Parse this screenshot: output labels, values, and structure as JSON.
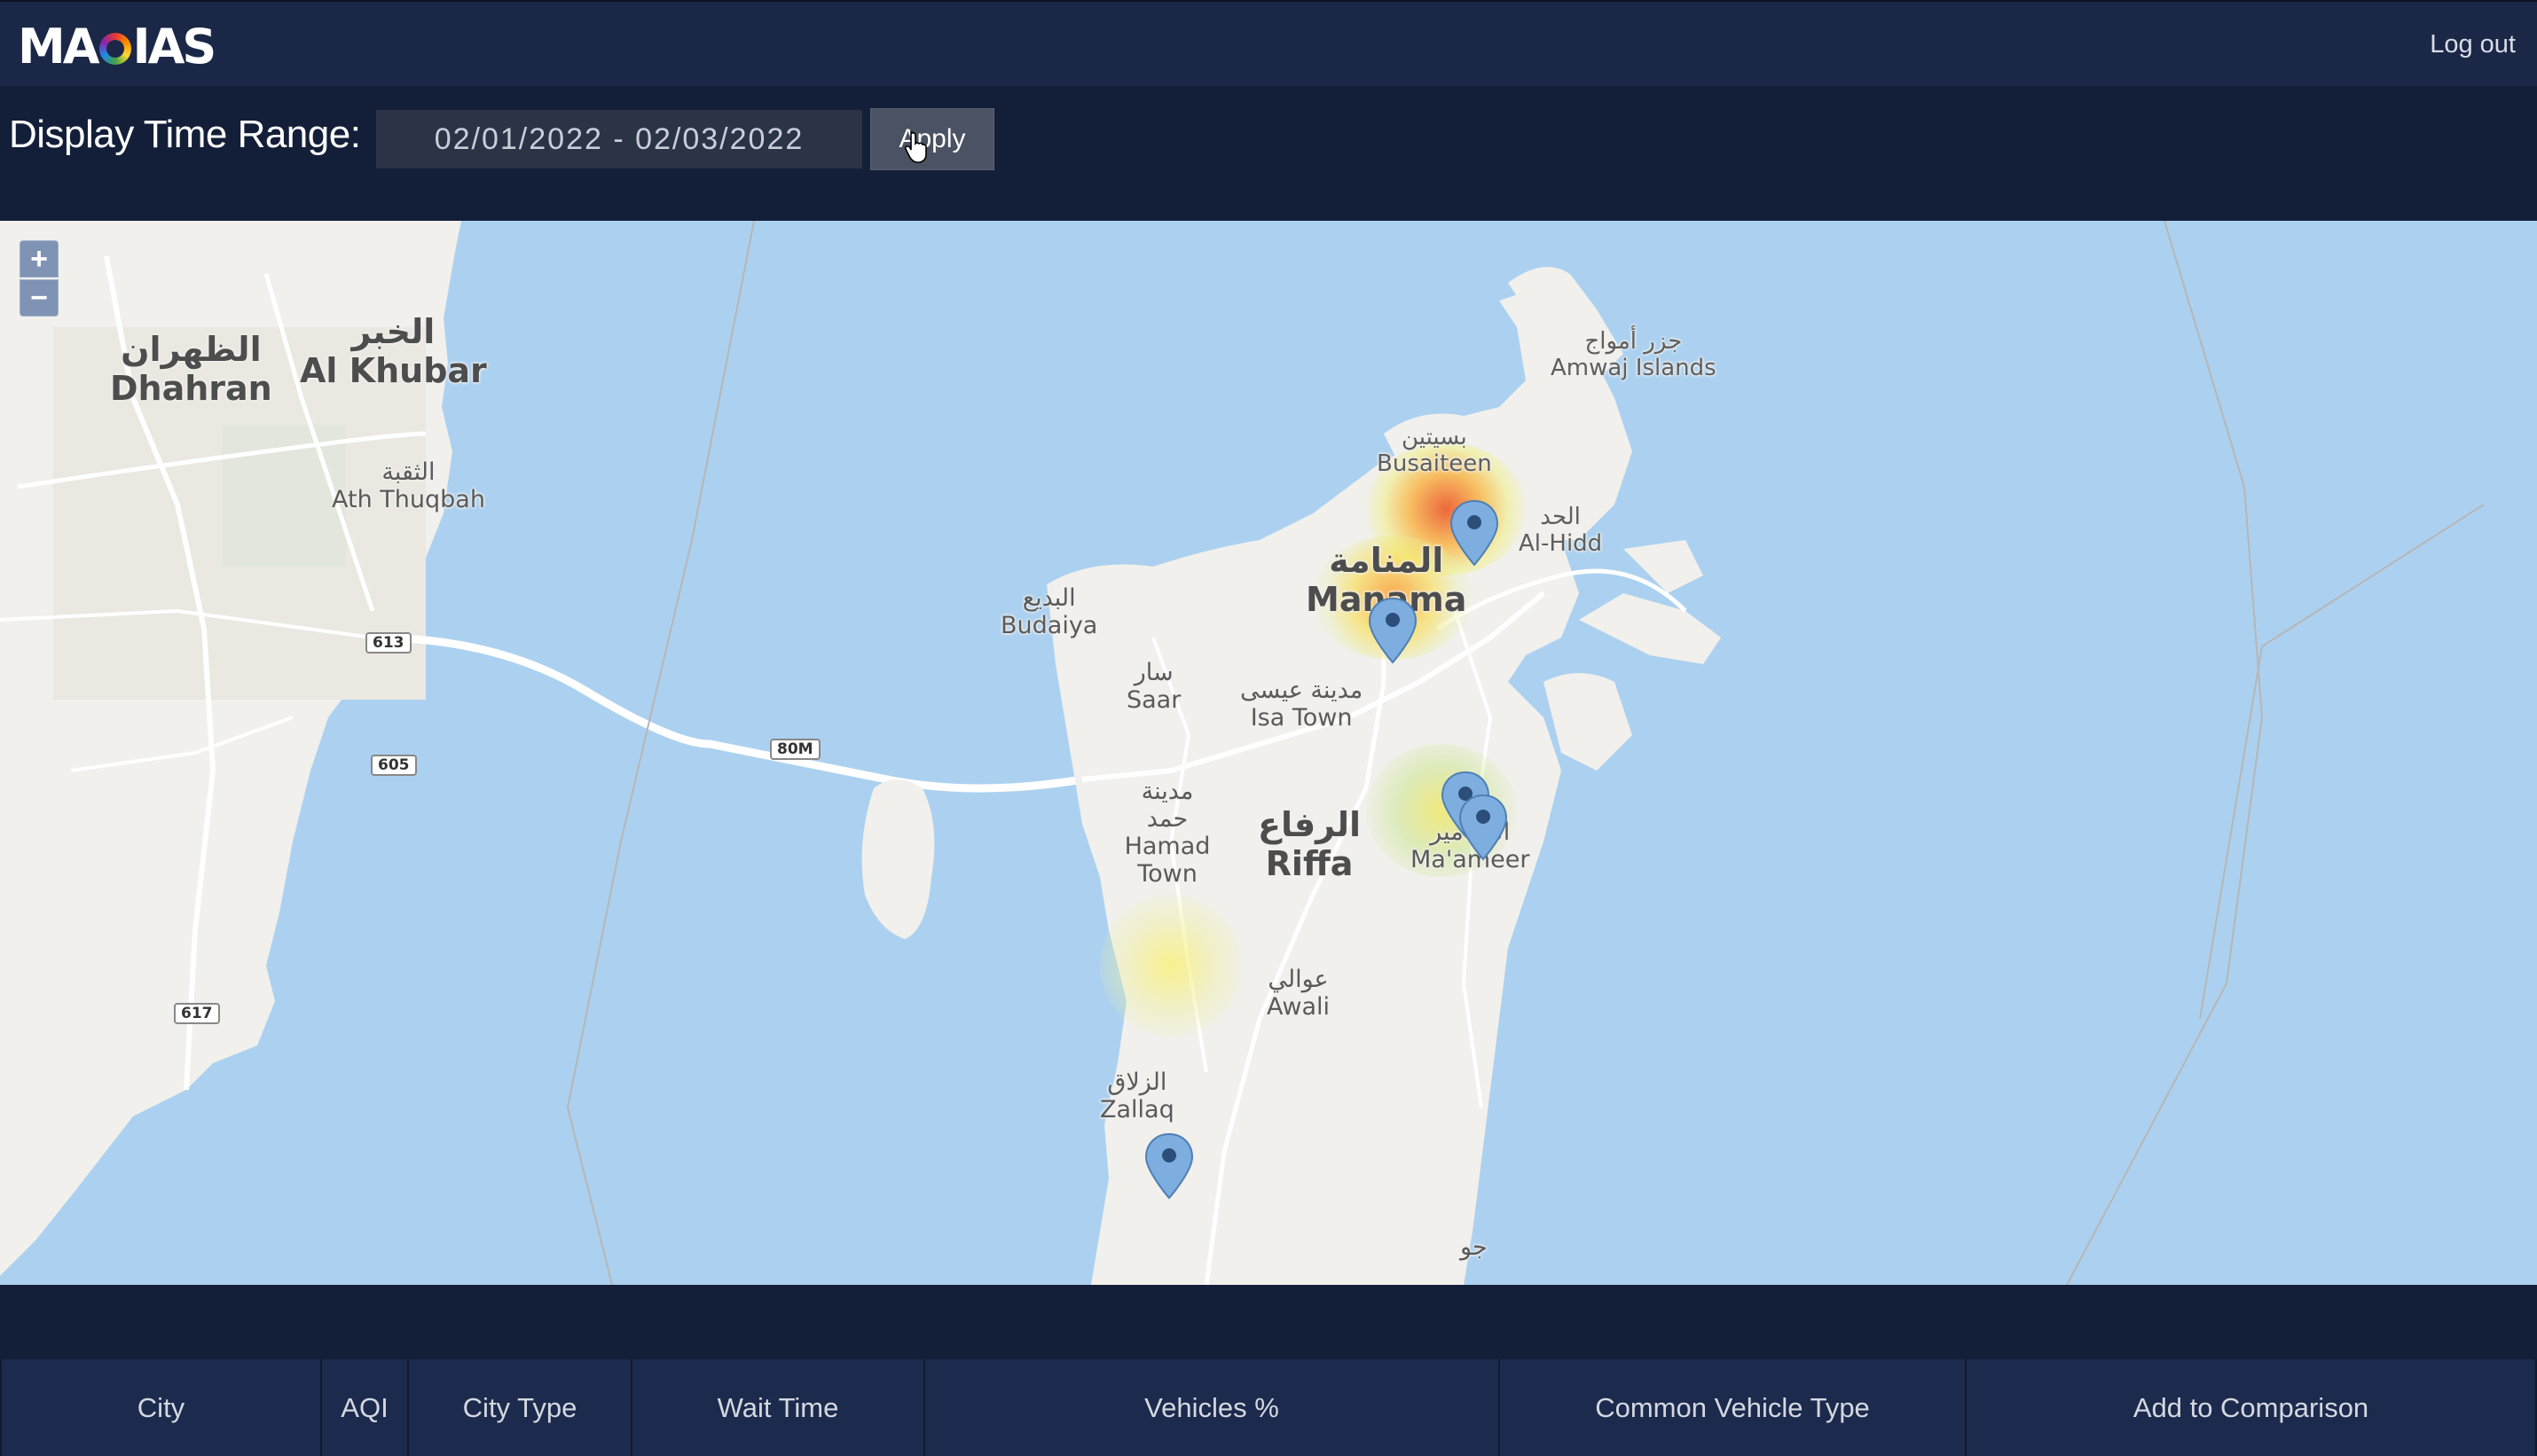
{
  "app": {
    "logo": {
      "before": "MA",
      "after": "IAS"
    },
    "logout_label": "Log out"
  },
  "range": {
    "label": "Display Time Range:",
    "value": "02/01/2022 - 02/03/2022",
    "apply_label": "Apply"
  },
  "map": {
    "zoom_in": "+",
    "zoom_out": "−",
    "places": {
      "dhahran_ar": "الظهران",
      "dhahran": "Dhahran",
      "khobar_ar": "الخبر",
      "khobar": "Al Khubar",
      "thuqbah_ar": "الثقبة",
      "thuqbah": "Ath Thuqbah",
      "amwaj_ar": "جزر أمواج",
      "amwaj": "Amwaj Islands",
      "busaiteen_ar": "بسيتين",
      "busaiteen": "Busaiteen",
      "hidd_ar": "الحد",
      "hidd": "Al-Hidd",
      "manama_ar": "المنامة",
      "manama": "Manama",
      "budaiya_ar": "البديع",
      "budaiya": "Budaiya",
      "saar_ar": "سار",
      "saar": "Saar",
      "isa_ar": "مدينة عيسى",
      "isa": "Isa Town",
      "hamad_ar": "مدينة حمد",
      "hamad": "Hamad Town",
      "riffa_ar": "الرفاع",
      "riffa": "Riffa",
      "maameer_ar": "المعامير",
      "maameer": "Ma'ameer",
      "awali_ar": "عوالي",
      "awali": "Awali",
      "zallaq_ar": "الزلاق",
      "zallaq": "Zallaq",
      "jaw_ar": "جو"
    },
    "road_shields": [
      "613",
      "605",
      "617",
      "80M"
    ],
    "markers": [
      "Busaiteen",
      "Manama",
      "Ma'ameer",
      "Ma'ameer",
      "Hamad Town"
    ]
  },
  "table": {
    "columns": [
      "City",
      "AQI",
      "City Type",
      "Wait Time",
      "Vehicles %",
      "Common Vehicle Type",
      "Add to Comparison"
    ]
  },
  "colors": {
    "header": "#1b2746",
    "water": "#acd1f0",
    "land": "#f1f0ec",
    "marker": "#7eaee0"
  }
}
